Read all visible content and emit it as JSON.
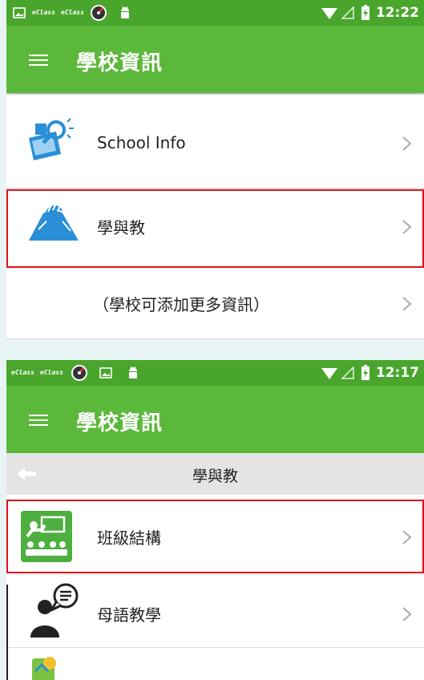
{
  "top_screen": {
    "status": {
      "app1": "eClass",
      "app2": "eClass",
      "time": "12:22"
    },
    "appbar_title": "學校資訊",
    "items": [
      {
        "label": "School Info"
      },
      {
        "label": "學與教"
      },
      {
        "label": "（學校可添加更多資訊）"
      }
    ]
  },
  "bottom_screen": {
    "status": {
      "app1": "eClass",
      "app2": "eClass",
      "time": "12:17"
    },
    "appbar_title": "學校資訊",
    "subheader_title": "學與教",
    "items": [
      {
        "label": "班級結構"
      },
      {
        "label": "母語教學"
      }
    ]
  },
  "colors": {
    "statusbar": "#49a52c",
    "appbar": "#5cb83b",
    "highlight": "#e0101a",
    "accent_blue": "#2a8fd6"
  }
}
